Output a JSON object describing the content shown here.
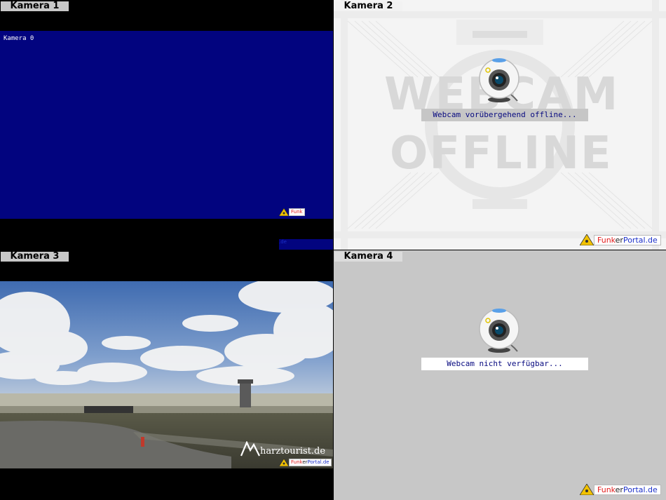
{
  "cameras": [
    {
      "label": "Kamera 1",
      "osd_text": "Kamera 0"
    },
    {
      "label": "Kamera 2",
      "watermark_top": "WEBCAM",
      "watermark_bottom": "OFFLINE",
      "status": "Webcam vorübergehend offline..."
    },
    {
      "label": "Kamera 3",
      "brand": "harztourist.de"
    },
    {
      "label": "Kamera 4",
      "status": "Webcam nicht verfügbar..."
    }
  ],
  "logo": {
    "part1": "Funk",
    "part2": "er",
    "part3": "Portal",
    "part4": ".de"
  },
  "colors": {
    "camera1_bg": "#02047f",
    "status_text": "#080a80",
    "logo_red": "#e31b1b",
    "logo_blue": "#1b2fc9"
  },
  "icons": [
    "webcam-icon",
    "antenna-warning-icon",
    "mountain-logo-icon"
  ]
}
